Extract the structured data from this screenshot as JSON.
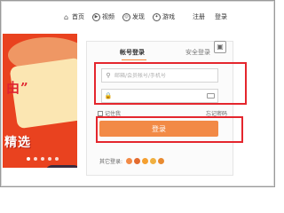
{
  "nav": {
    "items": [
      {
        "label": "首页",
        "icon": "home-icon"
      },
      {
        "label": "视频",
        "icon": "video-icon"
      },
      {
        "label": "发现",
        "icon": "discover-icon"
      },
      {
        "label": "游戏",
        "icon": "game-icon"
      }
    ],
    "register_label": "注册",
    "login_label": "登录"
  },
  "banner": {
    "text1": "由”",
    "text2": "精选",
    "slide_count": 5,
    "active_slide": 1
  },
  "login": {
    "tab_account": "帐号登录",
    "tab_secure": "安全登录",
    "account_placeholder": "邮箱/会员帐号/手机号",
    "password_placeholder": "",
    "remember_label": "记住我",
    "forgot_label": "忘记密码",
    "submit_label": "登录",
    "other_login_label": "其它登录:",
    "accent_color": "#f28a46",
    "highlight_color": "#e4262d",
    "social_icons": [
      "qq-icon",
      "weibo-icon",
      "baidu-icon",
      "renren-icon",
      "more-icon"
    ]
  }
}
